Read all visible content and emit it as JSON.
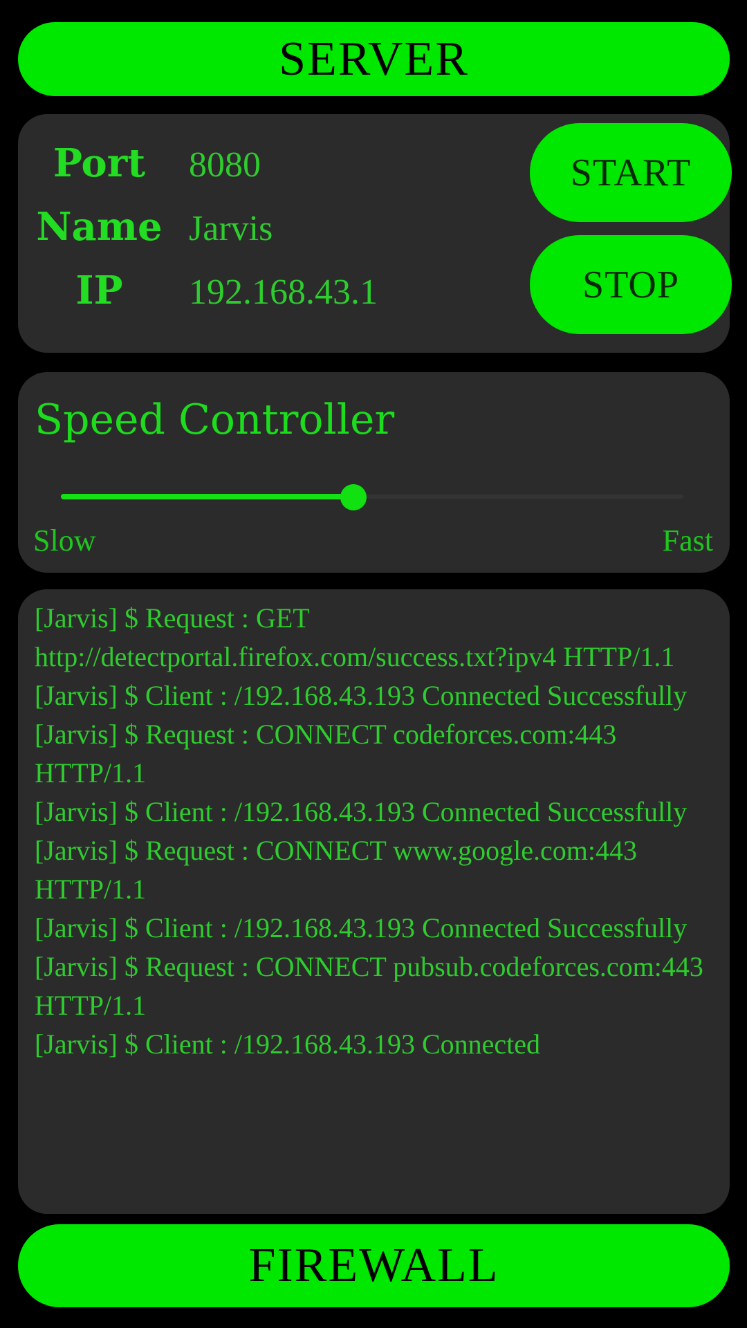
{
  "header": {
    "title": "SERVER"
  },
  "footer": {
    "title": "FIREWALL"
  },
  "server_info": {
    "rows": [
      {
        "label": "Port",
        "value": "8080"
      },
      {
        "label": "Name",
        "value": "Jarvis"
      },
      {
        "label": "IP",
        "value": "192.168.43.1"
      }
    ],
    "start_label": "START",
    "stop_label": "STOP"
  },
  "speed": {
    "title": "Speed Controller",
    "slow_label": "Slow",
    "fast_label": "Fast",
    "value_percent": 47
  },
  "log": {
    "text": "[Jarvis] $ Request : GET http://detectportal.firefox.com/success.txt?ipv4 HTTP/1.1\n[Jarvis] $ Client : /192.168.43.193 Connected Successfully\n[Jarvis] $ Request : CONNECT codeforces.com:443 HTTP/1.1\n[Jarvis] $ Client : /192.168.43.193 Connected Successfully\n[Jarvis] $ Request : CONNECT www.google.com:443 HTTP/1.1\n[Jarvis] $ Client : /192.168.43.193 Connected Successfully\n[Jarvis] $ Request : CONNECT pubsub.codeforces.com:443 HTTP/1.1\n[Jarvis] $ Client : /192.168.43.193 Connected"
  },
  "colors": {
    "background": "#000000",
    "card": "#2b2b2b",
    "accent_green": "#00e800",
    "text_green": "#2ecc2e"
  }
}
